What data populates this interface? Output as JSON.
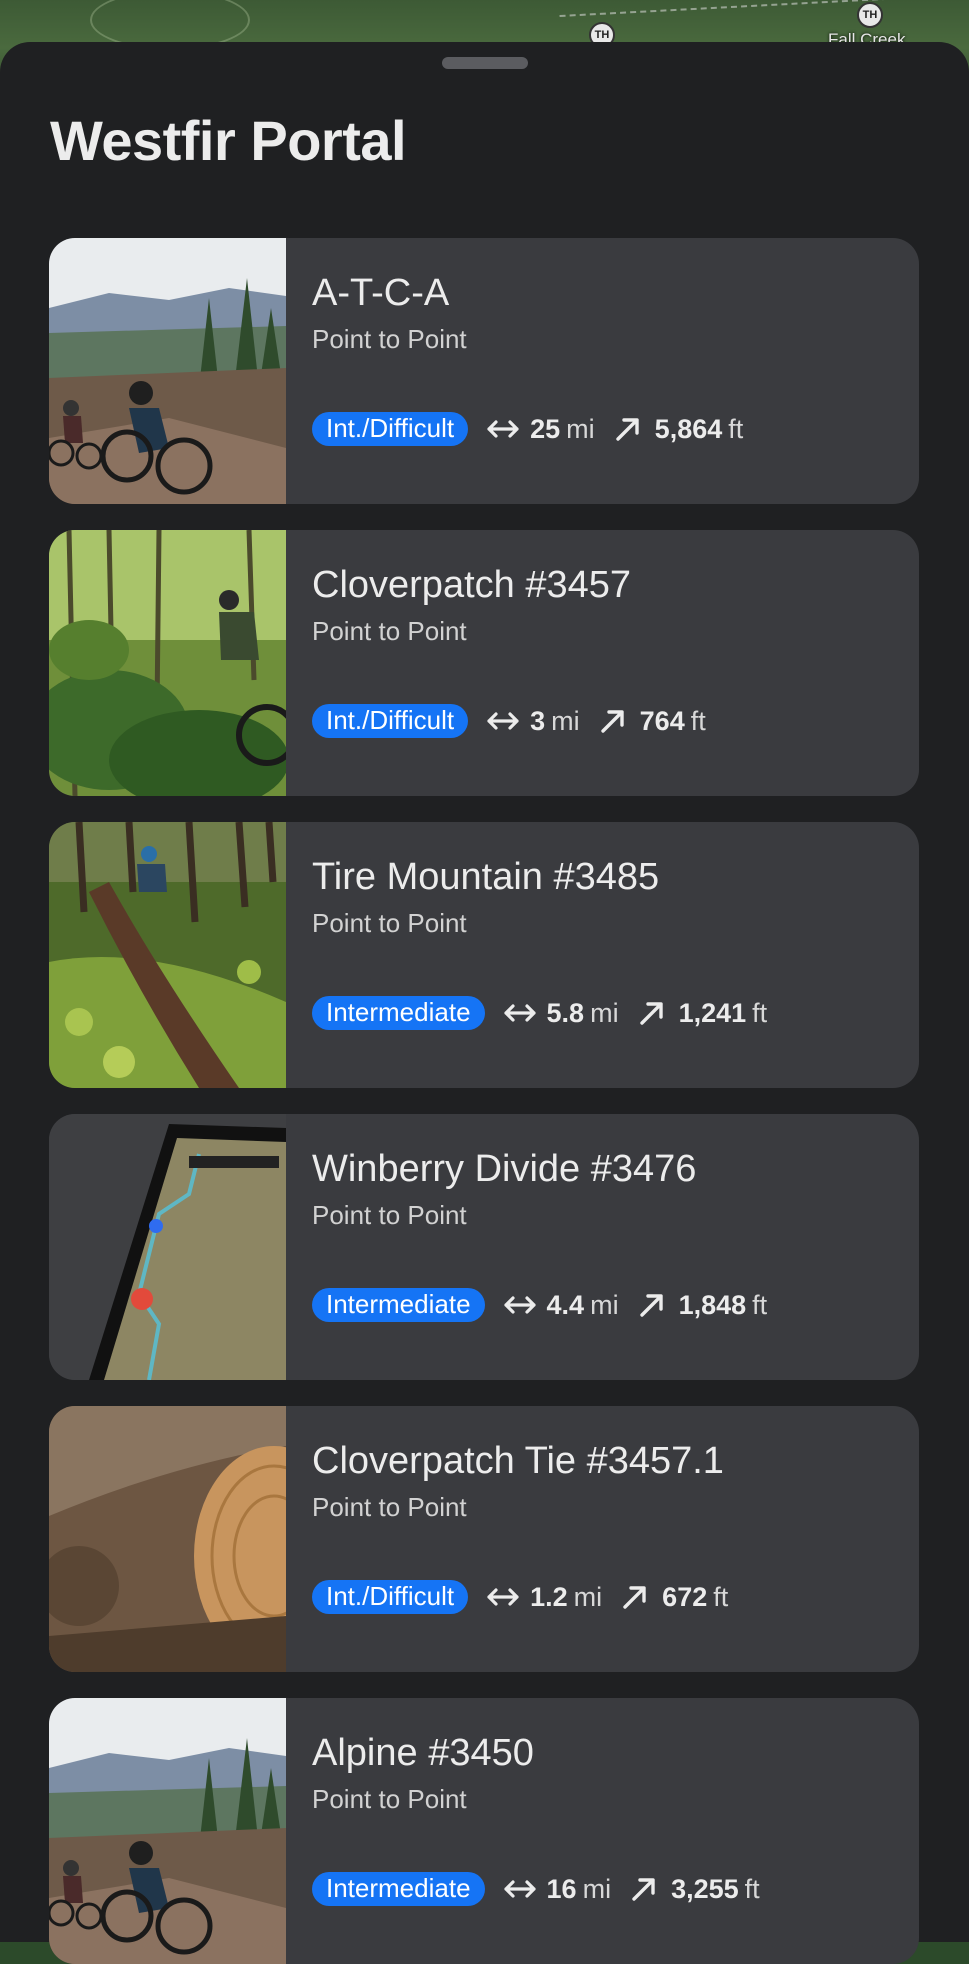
{
  "map": {
    "markers": [
      {
        "label": "TH"
      },
      {
        "label": "TH"
      }
    ],
    "place_label": "Fall Creek"
  },
  "sheet": {
    "title": "Westfir Portal"
  },
  "trails": [
    {
      "name": "A-T-C-A",
      "type": "Point to Point",
      "difficulty": "Int./Difficult",
      "distance": "25",
      "distance_unit": "mi",
      "elevation": "5,864",
      "elevation_unit": "ft",
      "photo": "rider-on-ridge-photo"
    },
    {
      "name": "Cloverpatch #3457",
      "type": "Point to Point",
      "difficulty": "Int./Difficult",
      "distance": "3",
      "distance_unit": "mi",
      "elevation": "764",
      "elevation_unit": "ft",
      "photo": "rider-in-forest-photo"
    },
    {
      "name": "Tire Mountain #3485",
      "type": "Point to Point",
      "difficulty": "Intermediate",
      "distance": "5.8",
      "distance_unit": "mi",
      "elevation": "1,241",
      "elevation_unit": "ft",
      "photo": "forest-singletrack-photo"
    },
    {
      "name": "Winberry Divide #3476",
      "type": "Point to Point",
      "difficulty": "Intermediate",
      "distance": "4.4",
      "distance_unit": "mi",
      "elevation": "1,848",
      "elevation_unit": "ft",
      "photo": "phone-map-photo"
    },
    {
      "name": "Cloverpatch Tie #3457.1",
      "type": "Point to Point",
      "difficulty": "Int./Difficult",
      "distance": "1.2",
      "distance_unit": "mi",
      "elevation": "672",
      "elevation_unit": "ft",
      "photo": "carved-log-photo"
    },
    {
      "name": "Alpine #3450",
      "type": "Point to Point",
      "difficulty": "Intermediate",
      "distance": "16",
      "distance_unit": "mi",
      "elevation": "3,255",
      "elevation_unit": "ft",
      "photo": "rider-on-ridge-photo"
    }
  ],
  "colors": {
    "badge": "#1574f5",
    "card": "#3a3b3f",
    "sheet": "#1f2022"
  },
  "icons": {
    "distance": "distance-arrows-icon",
    "elevation": "elevation-arrow-icon"
  }
}
